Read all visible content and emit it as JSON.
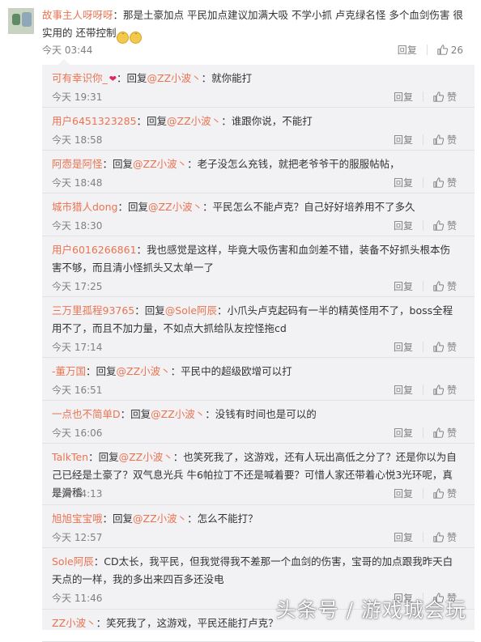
{
  "main_comment": {
    "username": "故事主人呀呀呀",
    "text": "：那是土豪加点 平民加点建议加满大吸 不学小抓 卢克绿名怪 多个血剑伤害 很实用的 还带控制",
    "time": "今天 03:44",
    "reply_label": "回复",
    "like_count": "26"
  },
  "replies": [
    {
      "user": "可有幸识你_",
      "mid": "：回复",
      "mention": "@ZZ小波丶",
      "text": "：就你能打",
      "time": "今天 19:31",
      "heart": true
    },
    {
      "user": "用户6451323285",
      "mid": "：回复",
      "mention": "@ZZ小波丶",
      "text": "：谁跟你说，不能打",
      "time": "今天 18:58"
    },
    {
      "user": "阿悫是阿怪",
      "mid": "：回复",
      "mention": "@ZZ小波丶",
      "text": "：老子没怎么充钱，就把老爷爷干的服服帖帖，",
      "time": "今天 18:48"
    },
    {
      "user": "城市猎人dong",
      "mid": "：回复",
      "mention": "@ZZ小波丶",
      "text": "：平民怎么不能卢克？自己好好培养用不了多久",
      "time": "今天 18:30"
    },
    {
      "user": "用户6016266861",
      "mid": "",
      "mention": "",
      "text": "：我也感觉是这样，毕竟大吸伤害和血剑差不错，装备不好抓头根本伤害不够，而且清小怪抓头又太单一了",
      "time": "今天 17:25"
    },
    {
      "user": "三万里孤程93765",
      "mid": "：回复",
      "mention": "@Sole阿辰",
      "text": "：小爪头卢克起码有一半的精英怪用不了，boss全程用不了，而且不加力量，不如点大抓给队友控怪拖cd",
      "time": "今天 17:14"
    },
    {
      "user": "-董万国",
      "mid": "：回复",
      "mention": "@ZZ小波丶",
      "text": "：平民中的超级欧增可以打",
      "time": "今天 16:51"
    },
    {
      "user": "一点也不简单D",
      "mid": "：回复",
      "mention": "@ZZ小波丶",
      "text": "：没钱有时间也是可以的",
      "time": "今天 16:06"
    },
    {
      "user": "TalkTen",
      "mid": "：回复",
      "mention": "@ZZ小波丶",
      "text": "：也笑死我了，这游戏，还有人玩出高低之分了？还是你以为自己已经是土豪了？双气息光兵 牛6帕拉丁不还是喊着要？可惜人家还带着心悦3光环呢，真是滑稽",
      "time": "今天 14:13"
    },
    {
      "user": "旭旭宝宝哦",
      "mid": "：回复",
      "mention": "@ZZ小波丶",
      "text": "：怎么不能打？",
      "time": "今天 12:57"
    },
    {
      "user": "Sole阿辰",
      "mid": "",
      "mention": "",
      "text": "：CD太长，我平民，但我觉得我不差那一个血剑的伤害，宝哥的加点跟我昨天白天点的一样，我的多出来四百多还没电",
      "time": "今天 11:46"
    },
    {
      "user": "ZZ小波丶",
      "mid": "",
      "mention": "",
      "text": "：笑死我了，这游戏，平民还能打卢克？",
      "time": ""
    }
  ],
  "reply_label": "回复",
  "like_label": "赞",
  "watermark": "头条号 / 游戏城会玩",
  "colors": {
    "username": "#eb7350",
    "meta": "#808080",
    "reply_bg": "#f2f2f5"
  },
  "icons": {
    "like": "thumbs-up-icon",
    "emoji": "smiley-cat-emoji-icon",
    "heart": "heart-icon"
  }
}
